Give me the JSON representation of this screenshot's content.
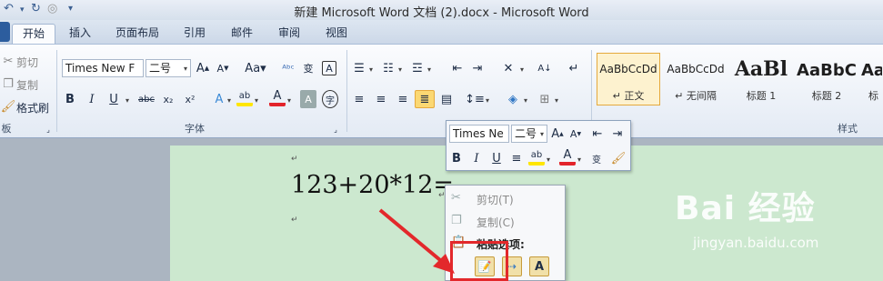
{
  "window": {
    "title": "新建 Microsoft Word 文档 (2).docx  -  Microsoft Word"
  },
  "tabs": [
    "开始",
    "插入",
    "页面布局",
    "引用",
    "邮件",
    "审阅",
    "视图"
  ],
  "active_tab": "开始",
  "clipboard": {
    "cut": "剪切",
    "copy": "复制",
    "format_painter": "格式刷",
    "label": "板"
  },
  "font": {
    "family": "Times New F",
    "size": "二号",
    "label": "字体"
  },
  "styles": {
    "label": "样式",
    "items": [
      {
        "preview": "AaBbCcDd",
        "name": "↵ 正文"
      },
      {
        "preview": "AaBbCcDd",
        "name": "↵ 无间隔"
      },
      {
        "preview": "AaBl",
        "name": "标题 1"
      },
      {
        "preview": "AaBbC",
        "name": "标题 2"
      },
      {
        "preview": "Aa",
        "name": "标"
      }
    ]
  },
  "document": {
    "formula": "123+20*12="
  },
  "mini_toolbar": {
    "font": "Times Ne",
    "size": "二号"
  },
  "context_menu": {
    "cut": "剪切(T)",
    "copy": "复制(C)",
    "paste_options": "粘贴选项:"
  },
  "watermark": {
    "brand": "Bai  经验",
    "url": "jingyan.baidu.com"
  },
  "colors": {
    "highlight_box": "#e3282b",
    "page_bg": "#cce8cf",
    "ribbon_bg": "#f1f5fb"
  }
}
